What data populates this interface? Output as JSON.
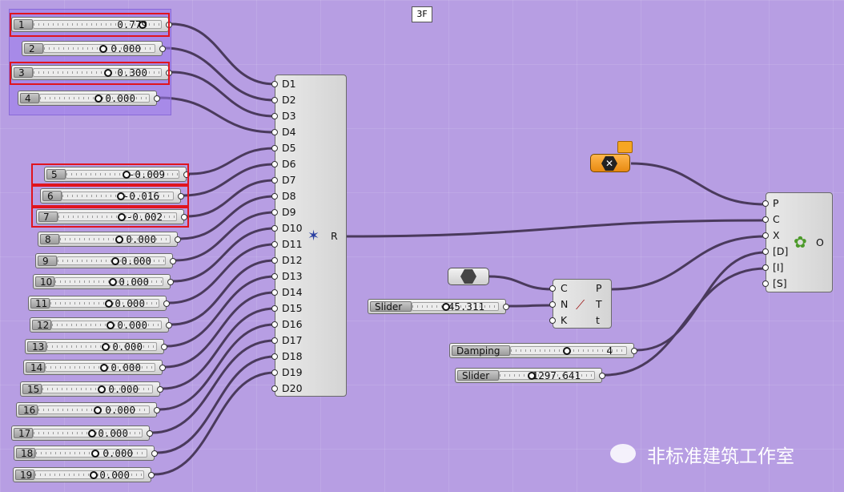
{
  "group_label": "3F",
  "sliders": [
    {
      "id": "1",
      "value": "0.779",
      "knob": 0.82
    },
    {
      "id": "2",
      "value": "0.000",
      "knob": 0.5
    },
    {
      "id": "3",
      "value": "0.300",
      "knob": 0.55
    },
    {
      "id": "4",
      "value": "0.000",
      "knob": 0.5
    },
    {
      "id": "5",
      "value": "-0.009",
      "knob": 0.5
    },
    {
      "id": "6",
      "value": "-0.016",
      "knob": 0.49
    },
    {
      "id": "7",
      "value": "-0.002",
      "knob": 0.5
    },
    {
      "id": "8",
      "value": "0.000",
      "knob": 0.5
    },
    {
      "id": "9",
      "value": "0.000",
      "knob": 0.5
    },
    {
      "id": "10",
      "value": "0.000",
      "knob": 0.5
    },
    {
      "id": "11",
      "value": "0.000",
      "knob": 0.5
    },
    {
      "id": "12",
      "value": "0.000",
      "knob": 0.5
    },
    {
      "id": "13",
      "value": "0.000",
      "knob": 0.5
    },
    {
      "id": "14",
      "value": "0.000",
      "knob": 0.5
    },
    {
      "id": "15",
      "value": "0.000",
      "knob": 0.5
    },
    {
      "id": "16",
      "value": "0.000",
      "knob": 0.5
    },
    {
      "id": "17",
      "value": "0.000",
      "knob": 0.5
    },
    {
      "id": "18",
      "value": "0.000",
      "knob": 0.5
    },
    {
      "id": "19",
      "value": "0.000",
      "knob": 0.5
    }
  ],
  "merge_component": {
    "inputs": [
      "D1",
      "D2",
      "D3",
      "D4",
      "D5",
      "D6",
      "D7",
      "D8",
      "D9",
      "D10",
      "D11",
      "D12",
      "D13",
      "D14",
      "D15",
      "D16",
      "D17",
      "D18",
      "D19",
      "D20"
    ],
    "output": "R"
  },
  "curve_component": {
    "inputs": [
      "C",
      "N",
      "K"
    ],
    "outputs": [
      "P",
      "T",
      "t"
    ]
  },
  "solver_component": {
    "inputs": [
      "P",
      "C",
      "X",
      "[D]",
      "[I]",
      "[S]"
    ],
    "output": "O"
  },
  "extra_sliders": [
    {
      "label": "Slider",
      "value": "45.311",
      "knob": 0.35
    },
    {
      "label": "Damping",
      "value": "4",
      "knob": 0.45
    },
    {
      "label": "Slider",
      "value": "1297.641",
      "knob": 0.3
    }
  ],
  "watermark": "非标准建筑工作室",
  "colors": {
    "canvas": "#b79ee3",
    "highlight": "#e0141e",
    "wire": "#4a3a5c",
    "toggle": "#f29b2a"
  }
}
